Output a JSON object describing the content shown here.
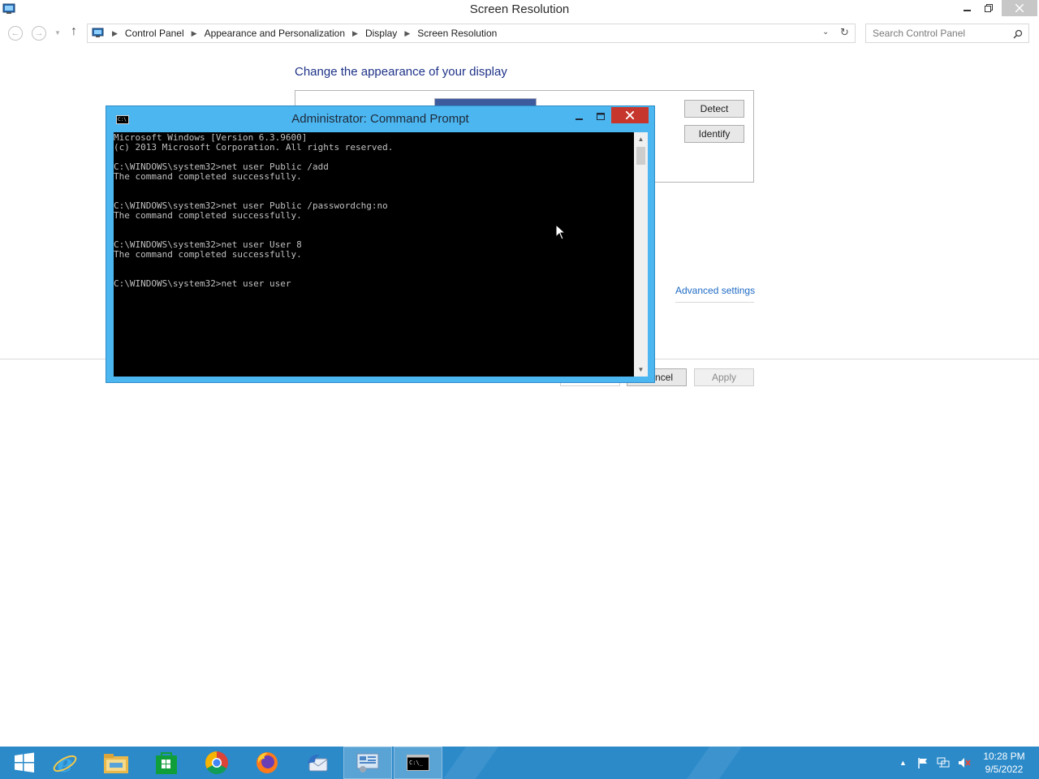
{
  "window": {
    "title": "Screen Resolution"
  },
  "address_bar": {
    "breadcrumbs": [
      "Control Panel",
      "Appearance and Personalization",
      "Display",
      "Screen Resolution"
    ],
    "search_placeholder": "Search Control Panel"
  },
  "page": {
    "heading": "Change the appearance of your display",
    "detect_label": "Detect",
    "identify_label": "Identify",
    "advanced_link": "Advanced settings",
    "cancel_partial": "ncel",
    "apply_label": "Apply"
  },
  "cmd_window": {
    "title": "Administrator: Command Prompt",
    "lines": [
      "Microsoft Windows [Version 6.3.9600]",
      "(c) 2013 Microsoft Corporation. All rights reserved.",
      "",
      "C:\\WINDOWS\\system32>net user Public /add",
      "The command completed successfully.",
      "",
      "",
      "C:\\WINDOWS\\system32>net user Public /passwordchg:no",
      "The command completed successfully.",
      "",
      "",
      "C:\\WINDOWS\\system32>net user User 8",
      "The command completed successfully.",
      "",
      "",
      "C:\\WINDOWS\\system32>net user user"
    ]
  },
  "taskbar": {
    "items": [
      "start-icon",
      "internet-explorer-icon",
      "file-explorer-icon",
      "store-icon",
      "chrome-icon",
      "firefox-icon",
      "thunderbird-icon",
      "control-panel-icon",
      "command-prompt-icon"
    ],
    "clock_time": "10:28 PM",
    "clock_date": "9/5/2022"
  },
  "colors": {
    "taskbar": "#2c8ac9",
    "cmd_frame": "#4cb6f0",
    "close_red": "#c7362c",
    "link_blue": "#1e6bc4",
    "heading_blue": "#1e3287"
  }
}
